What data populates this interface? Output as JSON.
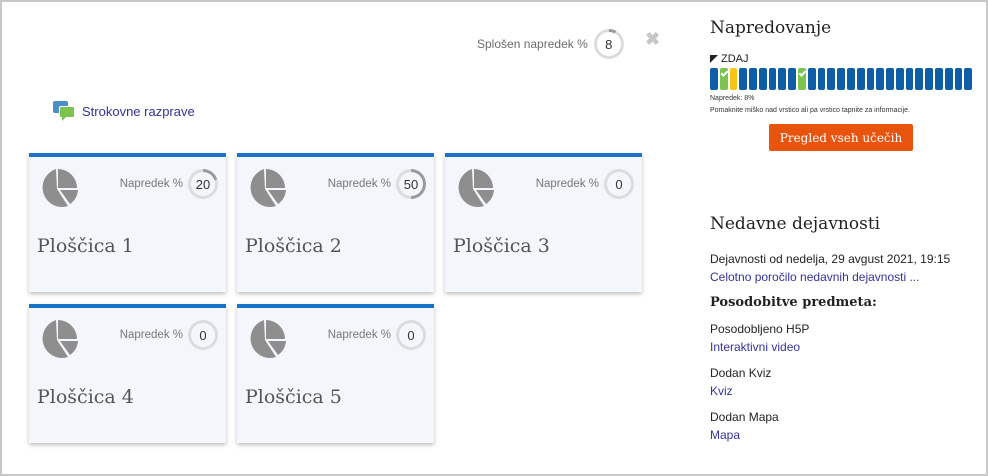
{
  "overall": {
    "label": "Splošen napredek %",
    "value": "8",
    "fraction": 0.08
  },
  "forum": {
    "label": "Strokovne razprave"
  },
  "tiles": [
    {
      "title": "Ploščica 1",
      "progress_label": "Napredek %",
      "progress": "20",
      "fraction": 0.2
    },
    {
      "title": "Ploščica 2",
      "progress_label": "Napredek %",
      "progress": "50",
      "fraction": 0.5
    },
    {
      "title": "Ploščica 3",
      "progress_label": "Napredek %",
      "progress": "0",
      "fraction": 0
    },
    {
      "title": "Ploščica 4",
      "progress_label": "Napredek %",
      "progress": "0",
      "fraction": 0
    },
    {
      "title": "Ploščica 5",
      "progress_label": "Napredek %",
      "progress": "0",
      "fraction": 0
    }
  ],
  "progress_block": {
    "heading": "Napredovanje",
    "now_label": "ZDAJ",
    "segments": [
      "",
      "done",
      "now",
      "",
      "",
      "",
      "",
      "",
      "",
      "done",
      "",
      "",
      "",
      "",
      "",
      "",
      "",
      "",
      "",
      "",
      "",
      "",
      "",
      "",
      "",
      "",
      ""
    ],
    "note": "Napredek: 8%",
    "hint": "Pomaknite miško nad vrstico ali pa vrstico tapnite za informacije.",
    "button_label": "Pregled vseh učečih"
  },
  "recent": {
    "heading": "Nedavne dejavnosti",
    "since": "Dejavnosti od nedelja, 29 avgust 2021, 19:15",
    "full_report": "Celotno poročilo nedavnih dejavnosti ...",
    "updates_heading": "Posodobitve predmeta:",
    "updates": [
      {
        "title": "Posodobljeno H5P",
        "link": "Interaktivni video"
      },
      {
        "title": "Dodan Kviz",
        "link": "Kviz"
      },
      {
        "title": "Dodan Mapa",
        "link": "Mapa"
      }
    ]
  },
  "colors": {
    "accent": "#1a73c8",
    "button": "#e8530e",
    "bar": "#0d5ea6",
    "done": "#7cc34f",
    "current": "#f5c518",
    "ring": "#9a9a9a",
    "ring_track": "#dcdcdc"
  },
  "icons": {
    "tile": "pie-chart-icon",
    "forum": "forum-icon",
    "close": "close-icon",
    "check": "check-icon",
    "flag": "flag-icon"
  }
}
